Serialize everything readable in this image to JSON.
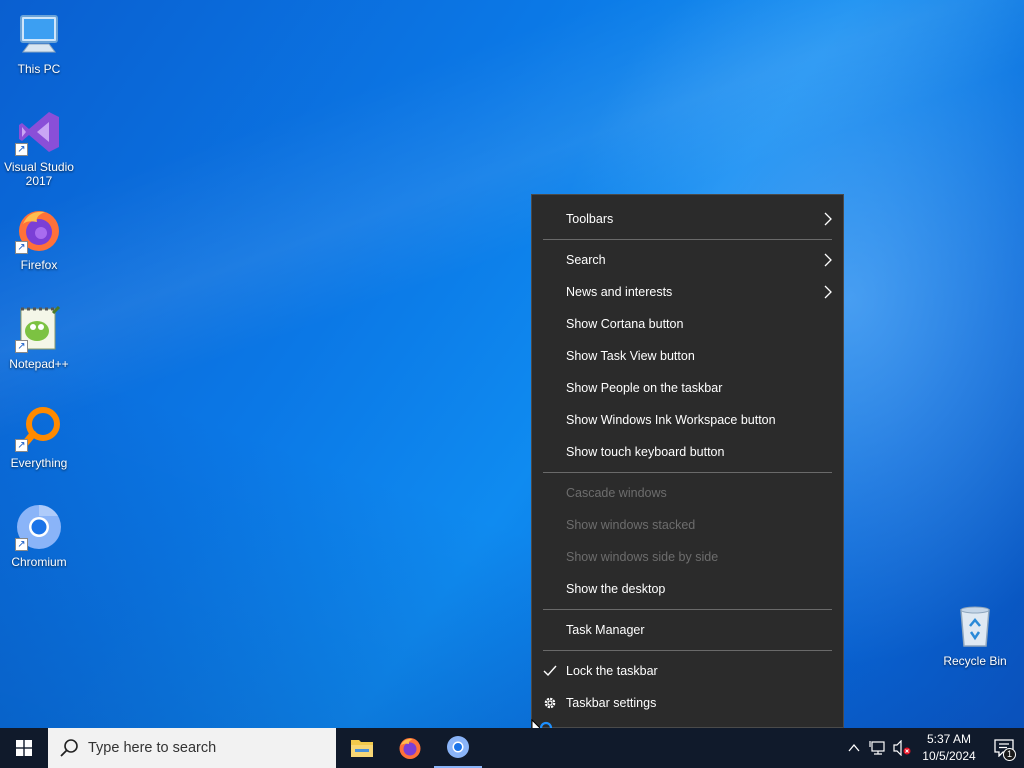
{
  "desktop": {
    "icons": [
      {
        "label": "This PC"
      },
      {
        "label": "Visual Studio 2017"
      },
      {
        "label": "Firefox"
      },
      {
        "label": "Notepad++"
      },
      {
        "label": "Everything"
      },
      {
        "label": "Chromium"
      },
      {
        "label": "Recycle Bin"
      }
    ]
  },
  "context_menu": {
    "items": [
      {
        "label": "Toolbars",
        "submenu": true
      },
      {
        "label": "Search",
        "submenu": true
      },
      {
        "label": "News and interests",
        "submenu": true
      },
      {
        "label": "Show Cortana button"
      },
      {
        "label": "Show Task View button"
      },
      {
        "label": "Show People on the taskbar"
      },
      {
        "label": "Show Windows Ink Workspace button"
      },
      {
        "label": "Show touch keyboard button"
      },
      {
        "label": "Cascade windows",
        "disabled": true
      },
      {
        "label": "Show windows stacked",
        "disabled": true
      },
      {
        "label": "Show windows side by side",
        "disabled": true
      },
      {
        "label": "Show the desktop"
      },
      {
        "label": "Task Manager"
      },
      {
        "label": "Lock the taskbar",
        "checked": true
      },
      {
        "label": "Taskbar settings",
        "icon": "gear-icon"
      }
    ]
  },
  "taskbar": {
    "search_placeholder": "Type here to search",
    "pinned": [
      {
        "name": "file-explorer-icon"
      },
      {
        "name": "firefox-icon"
      },
      {
        "name": "chromium-icon"
      }
    ],
    "clock": {
      "time": "5:37 AM",
      "date": "10/5/2024"
    },
    "notification_count": "1"
  },
  "colors": {
    "menu_bg": "#2b2b2b",
    "taskbar_bg": "#101a2b",
    "disabled_text": "#6d6d6d"
  }
}
